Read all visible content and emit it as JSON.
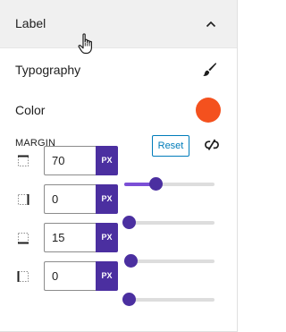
{
  "panel": {
    "title": "Label"
  },
  "typography": {
    "label": "Typography"
  },
  "color": {
    "label": "Color",
    "value": "#f4511e"
  },
  "margin": {
    "label": "MARGIN",
    "reset_label": "Reset",
    "unit": "PX",
    "max": 200,
    "sides": [
      {
        "side": "top",
        "value": "70"
      },
      {
        "side": "right",
        "value": "0"
      },
      {
        "side": "bottom",
        "value": "15"
      },
      {
        "side": "left",
        "value": "0"
      }
    ]
  },
  "colors": {
    "accent": "#4b2fa0",
    "reset_border": "#007cba"
  }
}
